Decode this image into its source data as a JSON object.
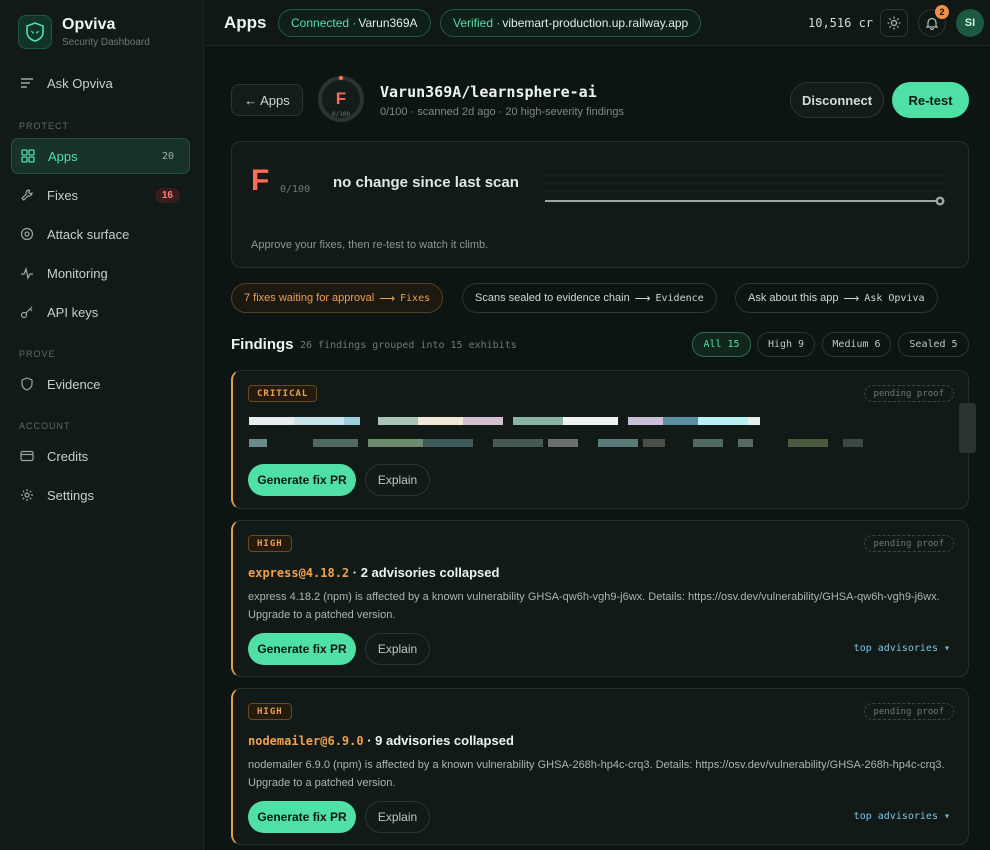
{
  "brand": {
    "name": "Opviva",
    "subtitle": "Security Dashboard"
  },
  "sidebar": {
    "ask": "Ask Opviva",
    "sections": {
      "protect": "PROTECT",
      "prove": "PROVE",
      "account": "ACCOUNT"
    },
    "items": [
      {
        "label": "Apps",
        "icon": "grid-icon",
        "count": "20",
        "active": true
      },
      {
        "label": "Fixes",
        "icon": "wrench-icon",
        "badge": "16"
      },
      {
        "label": "Attack surface",
        "icon": "target-icon"
      },
      {
        "label": "Monitoring",
        "icon": "pulse-icon"
      },
      {
        "label": "API keys",
        "icon": "key-icon"
      },
      {
        "label": "Evidence",
        "icon": "shield-icon"
      },
      {
        "label": "Credits",
        "icon": "card-icon"
      },
      {
        "label": "Settings",
        "icon": "gear-icon"
      }
    ]
  },
  "topbar": {
    "title": "Apps",
    "connected_key": "Connected ·",
    "connected_val": "Varun369A",
    "verified_key": "Verified ·",
    "verified_val": "vibemart-production.up.railway.app",
    "credits": "10,516 cr",
    "notifications": "2",
    "avatar": "SI"
  },
  "app": {
    "back": "← Apps",
    "grade": "F",
    "score_label": "0/100",
    "repo": "Varun369A/learnsphere-ai",
    "meta": "0/100 · scanned 2d ago · 20 high-severity findings",
    "score": 0,
    "disconnect": "Disconnect",
    "retest": "Re-test"
  },
  "score_card": {
    "grade": "F",
    "of": "0/100",
    "status": "no change since last scan",
    "hint": "Approve your fixes, then re-test to watch it climb."
  },
  "actions": [
    {
      "label": "7 fixes waiting for approval",
      "target": "Fixes"
    },
    {
      "label": "Scans sealed to evidence chain",
      "target": "Evidence"
    },
    {
      "label": "Ask about this app",
      "target": "Ask Opviva"
    }
  ],
  "findings": {
    "title": "Findings",
    "subtitle": "26 findings grouped into 15 exhibits",
    "filters": [
      "All 15",
      "High 9",
      "Medium 6",
      "Sealed 5"
    ]
  },
  "cards": [
    {
      "severity": "CRITICAL",
      "proof": "pending proof",
      "generate": "Generate fix PR",
      "explain": "Explain"
    },
    {
      "severity": "HIGH",
      "proof": "pending proof",
      "pkg": "express@4.18.2",
      "summary": " · 2 advisories collapsed",
      "desc": "express 4.18.2 (npm) is affected by a known vulnerability GHSA-qw6h-vgh9-j6wx. Details: https://osv.dev/vulnerability/GHSA-qw6h-vgh9-j6wx. Upgrade to a patched version.",
      "generate": "Generate fix PR",
      "explain": "Explain",
      "advisories": "top advisories ▾"
    },
    {
      "severity": "HIGH",
      "proof": "pending proof",
      "pkg": "nodemailer@6.9.0",
      "summary": " · 9 advisories collapsed",
      "desc": "nodemailer 6.9.0 (npm) is affected by a known vulnerability GHSA-268h-hp4c-crq3. Details: https://osv.dev/vulnerability/GHSA-268h-hp4c-crq3. Upgrade to a patched version.",
      "generate": "Generate fix PR",
      "explain": "Explain",
      "advisories": "top advisories ▾"
    }
  ],
  "colors": {
    "accent": "#4fe0a5",
    "danger": "#ff6a5a",
    "warning": "#f0a04a",
    "background": "#0d1512"
  }
}
